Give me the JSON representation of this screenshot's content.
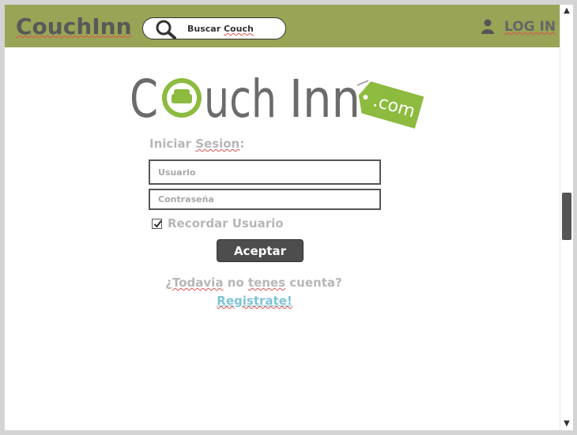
{
  "header": {
    "brand": "CouchInn",
    "search": {
      "label_part1": "Buscar",
      "label_part2": "Couch"
    },
    "login": "LOG IN"
  },
  "logo": {
    "text": "Couch Inn",
    "tag": ".com",
    "accent_color": "#8dbb3f"
  },
  "form": {
    "heading_part1": "Iniciar",
    "heading_part2": "Sesion",
    "heading_part3": ":",
    "username_placeholder": "Usuario",
    "password_placeholder": "Contraseña",
    "remember_label": "Recordar Usuario",
    "remember_checked": true,
    "submit_label": "Aceptar"
  },
  "signup": {
    "prompt_part1": "¿Todavia",
    "prompt_part2": "no",
    "prompt_part3": "tenes",
    "prompt_part4": "cuenta?",
    "link": "Registrate!"
  },
  "colors": {
    "header_bg": "#99a456",
    "button_bg": "#4d4d4d",
    "link": "#7fc3d6"
  },
  "icons": [
    "search-icon",
    "user-icon",
    "check-icon",
    "scroll-up-arrow",
    "scroll-down-arrow"
  ]
}
